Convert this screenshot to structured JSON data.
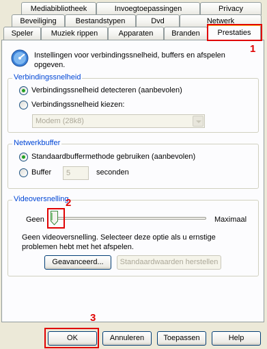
{
  "tabs_row1": [
    "Mediabibliotheek",
    "Invoegtoepassingen",
    "Privacy"
  ],
  "tabs_row2": [
    "Beveiliging",
    "Bestandstypen",
    "Dvd",
    "Netwerk"
  ],
  "tabs_row3": [
    "Speler",
    "Muziek rippen",
    "Apparaten",
    "Branden",
    "Prestaties"
  ],
  "intro_text": "Instellingen voor verbindingssnelheid, buffers en afspelen opgeven.",
  "connection": {
    "title": "Verbindingssnelheid",
    "detect_label": "Verbindingssnelheid detecteren (aanbevolen)",
    "choose_label": "Verbindingssnelheid kiezen:",
    "speed_value": "Modem (28k8)"
  },
  "buffer": {
    "title": "Netwerkbuffer",
    "default_label": "Standaardbuffermethode gebruiken (aanbevolen)",
    "buffer_label": "Buffer",
    "seconds_value": "5",
    "seconds_label": "seconden"
  },
  "video": {
    "title": "Videoversnelling",
    "min_label": "Geen",
    "max_label": "Maximaal",
    "slider_level": 0,
    "description": "Geen videoversnelling. Selecteer deze optie als u ernstige problemen hebt met het afspelen.",
    "advanced_button": "Geavanceerd...",
    "reset_button": "Standaardwaarden herstellen"
  },
  "footer": {
    "ok": "OK",
    "cancel": "Annuleren",
    "apply": "Toepassen",
    "help": "Help"
  },
  "markers": [
    "1",
    "2",
    "3"
  ],
  "colors": {
    "accent_blue": "#0046d5",
    "callout_red": "#e00000",
    "active_tab_top": "#ffc83c"
  }
}
